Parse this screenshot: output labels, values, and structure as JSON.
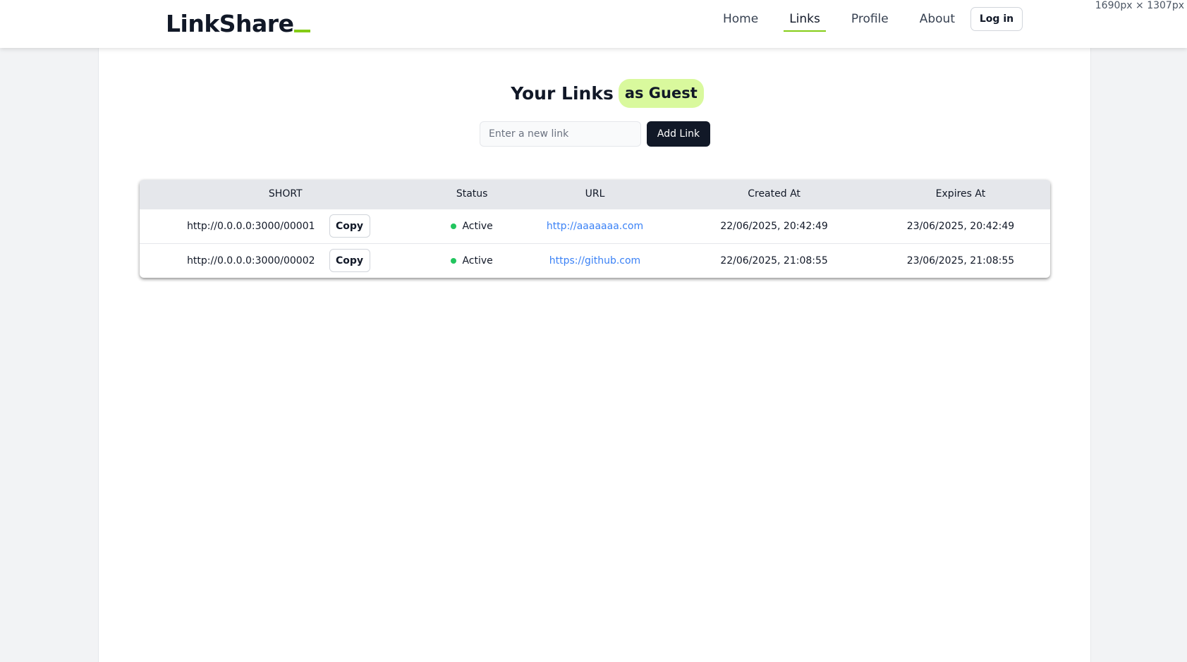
{
  "app": {
    "logo_text": "LinkShare",
    "dimension_readout": "1690px × 1307px"
  },
  "nav": {
    "items": [
      {
        "label": "Home",
        "active": false
      },
      {
        "label": "Links",
        "active": true
      },
      {
        "label": "Profile",
        "active": false
      },
      {
        "label": "About",
        "active": false
      }
    ],
    "login_label": "Log in"
  },
  "page": {
    "heading": "Your Links",
    "badge": "as Guest"
  },
  "form": {
    "input_placeholder": "Enter a new link",
    "input_value": "",
    "add_label": "Add Link"
  },
  "table": {
    "headers": [
      "SHORT",
      "Status",
      "URL",
      "Created At",
      "Expires At"
    ],
    "copy_label": "Copy",
    "rows": [
      {
        "short": "http://0.0.0.0:3000/00001",
        "status": "Active",
        "url": "http://aaaaaaa.com",
        "created_at": "22/06/2025, 20:42:49",
        "expires_at": "23/06/2025, 20:42:49"
      },
      {
        "short": "http://0.0.0.0:3000/00002",
        "status": "Active",
        "url": "https://github.com",
        "created_at": "22/06/2025, 21:08:55",
        "expires_at": "23/06/2025, 21:08:55"
      }
    ]
  },
  "colors": {
    "accent": "#84cc16",
    "badge_bg": "#d9f99d",
    "primary_button": "#111827",
    "link": "#3b82f6",
    "status_active": "#22c55e"
  }
}
